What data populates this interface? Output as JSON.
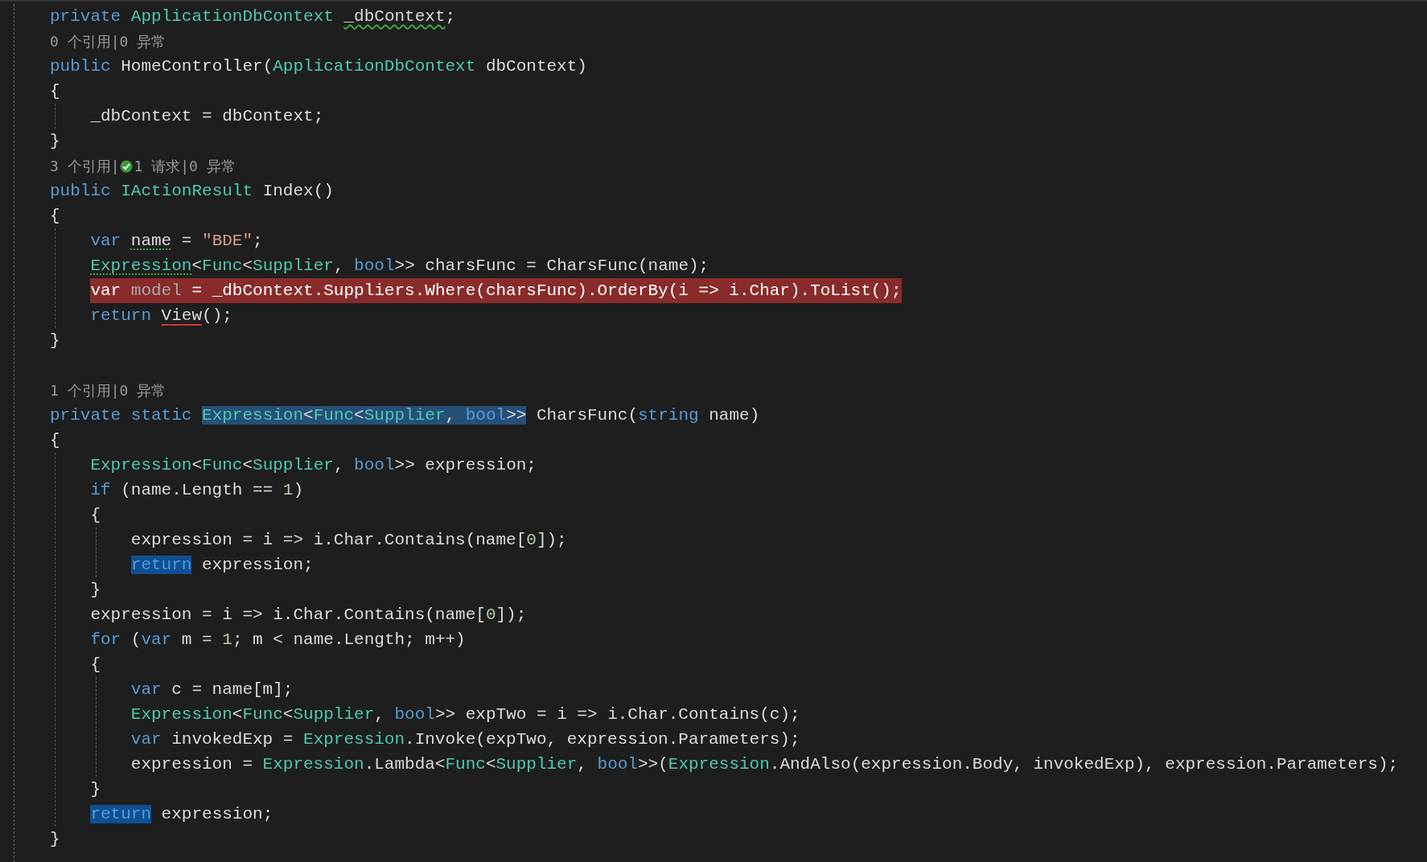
{
  "editor": {
    "lines": [
      {
        "kind": "code",
        "tokens": [
          {
            "text": "private ",
            "kind": "keyword"
          },
          {
            "text": "ApplicationDbContext ",
            "kind": "type"
          },
          {
            "text": "_dbContext",
            "kind": "plain",
            "warning_squiggle": true
          },
          {
            "text": ";",
            "kind": "plain"
          }
        ]
      },
      {
        "kind": "lens",
        "parts": [
          {
            "text": "0 个引用|0 异常",
            "passed": false
          }
        ]
      },
      {
        "kind": "code",
        "tokens": [
          {
            "text": "public ",
            "kind": "keyword"
          },
          {
            "text": "HomeController(",
            "kind": "plain"
          },
          {
            "text": "ApplicationDbContext ",
            "kind": "type"
          },
          {
            "text": "dbContext)",
            "kind": "plain"
          }
        ]
      },
      {
        "kind": "code",
        "tokens": [
          {
            "text": "{",
            "kind": "plain"
          }
        ],
        "children": [
          {
            "kind": "code",
            "tokens": [
              {
                "text": "_dbContext = dbContext;",
                "kind": "plain"
              }
            ]
          }
        ]
      },
      {
        "kind": "code",
        "tokens": [
          {
            "text": "}",
            "kind": "plain"
          }
        ]
      },
      {
        "kind": "lens",
        "parts": [
          {
            "text": "3 个引用|",
            "passed": false
          },
          {
            "text": "1 请求|0 异常",
            "passed": true
          }
        ]
      },
      {
        "kind": "code",
        "tokens": [
          {
            "text": "public ",
            "kind": "keyword"
          },
          {
            "text": "IActionResult ",
            "kind": "type"
          },
          {
            "text": "Index()",
            "kind": "plain"
          }
        ]
      },
      {
        "kind": "code",
        "tokens": [
          {
            "text": "{",
            "kind": "plain"
          }
        ],
        "children": [
          {
            "kind": "code",
            "tokens": [
              {
                "text": "var ",
                "kind": "keyword"
              },
              {
                "text": "name",
                "kind": "plain",
                "suggestion_dots": true
              },
              {
                "text": " = ",
                "kind": "plain"
              },
              {
                "text": "\"BDE\"",
                "kind": "string"
              },
              {
                "text": ";",
                "kind": "plain"
              }
            ]
          },
          {
            "kind": "code",
            "tokens": [
              {
                "text": "Expression",
                "kind": "type",
                "suggestion_dots": true
              },
              {
                "text": "<",
                "kind": "plain"
              },
              {
                "text": "Func",
                "kind": "type"
              },
              {
                "text": "<",
                "kind": "plain"
              },
              {
                "text": "Supplier",
                "kind": "type"
              },
              {
                "text": ", ",
                "kind": "plain"
              },
              {
                "text": "bool",
                "kind": "keyword"
              },
              {
                "text": ">> charsFunc = CharsFunc(name);",
                "kind": "plain"
              }
            ]
          },
          {
            "kind": "code",
            "breakpoint": true,
            "tokens": [
              {
                "text": "var ",
                "kind": "keyword"
              },
              {
                "text": "model",
                "kind": "unused"
              },
              {
                "text": " = _dbContext.Suppliers.Where(charsFunc).OrderBy(i => i.Char).ToList();",
                "kind": "plain"
              }
            ]
          },
          {
            "kind": "code",
            "tokens": [
              {
                "text": "return ",
                "kind": "keyword"
              },
              {
                "text": "View",
                "kind": "plain",
                "error_squiggle": true
              },
              {
                "text": "();",
                "kind": "plain"
              }
            ]
          }
        ]
      },
      {
        "kind": "code",
        "tokens": [
          {
            "text": "}",
            "kind": "plain"
          }
        ]
      },
      {
        "kind": "blank"
      },
      {
        "kind": "lens",
        "parts": [
          {
            "text": "1 个引用|0 异常",
            "passed": false
          }
        ]
      },
      {
        "kind": "code",
        "tokens": [
          {
            "text": "private static ",
            "kind": "keyword"
          },
          {
            "text": "Expression",
            "kind": "type",
            "selected": true
          },
          {
            "text": "<",
            "kind": "plain",
            "selected": true
          },
          {
            "text": "Func",
            "kind": "type",
            "selected": true
          },
          {
            "text": "<",
            "kind": "plain",
            "selected": true
          },
          {
            "text": "Supplier",
            "kind": "type",
            "selected": true
          },
          {
            "text": ", ",
            "kind": "plain",
            "selected": true
          },
          {
            "text": "bool",
            "kind": "keyword",
            "selected": true
          },
          {
            "text": ">>",
            "kind": "plain",
            "selected": true
          },
          {
            "text": " CharsFunc(",
            "kind": "plain"
          },
          {
            "text": "string ",
            "kind": "keyword"
          },
          {
            "text": "name)",
            "kind": "plain"
          }
        ]
      },
      {
        "kind": "code",
        "tokens": [
          {
            "text": "{",
            "kind": "plain"
          }
        ],
        "children": [
          {
            "kind": "code",
            "tokens": [
              {
                "text": "Expression",
                "kind": "type"
              },
              {
                "text": "<",
                "kind": "plain"
              },
              {
                "text": "Func",
                "kind": "type"
              },
              {
                "text": "<",
                "kind": "plain"
              },
              {
                "text": "Supplier",
                "kind": "type"
              },
              {
                "text": ", ",
                "kind": "plain"
              },
              {
                "text": "bool",
                "kind": "keyword"
              },
              {
                "text": ">> expression;",
                "kind": "plain"
              }
            ]
          },
          {
            "kind": "code",
            "tokens": [
              {
                "text": "if ",
                "kind": "keyword"
              },
              {
                "text": "(name.Length == ",
                "kind": "plain"
              },
              {
                "text": "1",
                "kind": "number"
              },
              {
                "text": ")",
                "kind": "plain"
              }
            ]
          },
          {
            "kind": "code",
            "tokens": [
              {
                "text": "{",
                "kind": "plain"
              }
            ],
            "children": [
              {
                "kind": "code",
                "tokens": [
                  {
                    "text": "expression = i => i.Char.Contains(name[",
                    "kind": "plain"
                  },
                  {
                    "text": "0",
                    "kind": "number"
                  },
                  {
                    "text": "]);",
                    "kind": "plain"
                  }
                ]
              },
              {
                "kind": "code",
                "tokens": [
                  {
                    "text": "return",
                    "kind": "keyword",
                    "reference_highlight": true
                  },
                  {
                    "text": " expression;",
                    "kind": "plain"
                  }
                ]
              }
            ]
          },
          {
            "kind": "code",
            "tokens": [
              {
                "text": "}",
                "kind": "plain"
              }
            ]
          },
          {
            "kind": "code",
            "tokens": [
              {
                "text": "expression = i => i.Char.Contains(name[",
                "kind": "plain"
              },
              {
                "text": "0",
                "kind": "number"
              },
              {
                "text": "]);",
                "kind": "plain"
              }
            ]
          },
          {
            "kind": "code",
            "tokens": [
              {
                "text": "for ",
                "kind": "keyword"
              },
              {
                "text": "(",
                "kind": "plain"
              },
              {
                "text": "var ",
                "kind": "keyword"
              },
              {
                "text": "m = ",
                "kind": "plain"
              },
              {
                "text": "1",
                "kind": "number"
              },
              {
                "text": "; m < name.Length; m++)",
                "kind": "plain"
              }
            ]
          },
          {
            "kind": "code",
            "tokens": [
              {
                "text": "{",
                "kind": "plain"
              }
            ],
            "children": [
              {
                "kind": "code",
                "tokens": [
                  {
                    "text": "var ",
                    "kind": "keyword"
                  },
                  {
                    "text": "c = name[m];",
                    "kind": "plain"
                  }
                ]
              },
              {
                "kind": "code",
                "tokens": [
                  {
                    "text": "Expression",
                    "kind": "type"
                  },
                  {
                    "text": "<",
                    "kind": "plain"
                  },
                  {
                    "text": "Func",
                    "kind": "type"
                  },
                  {
                    "text": "<",
                    "kind": "plain"
                  },
                  {
                    "text": "Supplier",
                    "kind": "type"
                  },
                  {
                    "text": ", ",
                    "kind": "plain"
                  },
                  {
                    "text": "bool",
                    "kind": "keyword"
                  },
                  {
                    "text": ">> expTwo = i => i.Char.Contains(c);",
                    "kind": "plain"
                  }
                ]
              },
              {
                "kind": "code",
                "tokens": [
                  {
                    "text": "var ",
                    "kind": "keyword"
                  },
                  {
                    "text": "invokedExp = ",
                    "kind": "plain"
                  },
                  {
                    "text": "Expression",
                    "kind": "type"
                  },
                  {
                    "text": ".Invoke(expTwo, expression.Parameters);",
                    "kind": "plain"
                  }
                ]
              },
              {
                "kind": "code",
                "tokens": [
                  {
                    "text": "expression = ",
                    "kind": "plain"
                  },
                  {
                    "text": "Expression",
                    "kind": "type"
                  },
                  {
                    "text": ".Lambda<",
                    "kind": "plain"
                  },
                  {
                    "text": "Func",
                    "kind": "type"
                  },
                  {
                    "text": "<",
                    "kind": "plain"
                  },
                  {
                    "text": "Supplier",
                    "kind": "type"
                  },
                  {
                    "text": ", ",
                    "kind": "plain"
                  },
                  {
                    "text": "bool",
                    "kind": "keyword"
                  },
                  {
                    "text": ">>(",
                    "kind": "plain"
                  },
                  {
                    "text": "Expression",
                    "kind": "type"
                  },
                  {
                    "text": ".AndAlso(expression.Body, invokedExp), expression.Parameters);",
                    "kind": "plain"
                  }
                ]
              }
            ]
          },
          {
            "kind": "code",
            "tokens": [
              {
                "text": "}",
                "kind": "plain"
              }
            ]
          },
          {
            "kind": "code",
            "tokens": [
              {
                "text": "return",
                "kind": "keyword",
                "reference_highlight": true
              },
              {
                "text": " expression;",
                "kind": "plain"
              }
            ]
          }
        ]
      },
      {
        "kind": "code",
        "tokens": [
          {
            "text": "}",
            "kind": "plain"
          }
        ]
      }
    ]
  }
}
